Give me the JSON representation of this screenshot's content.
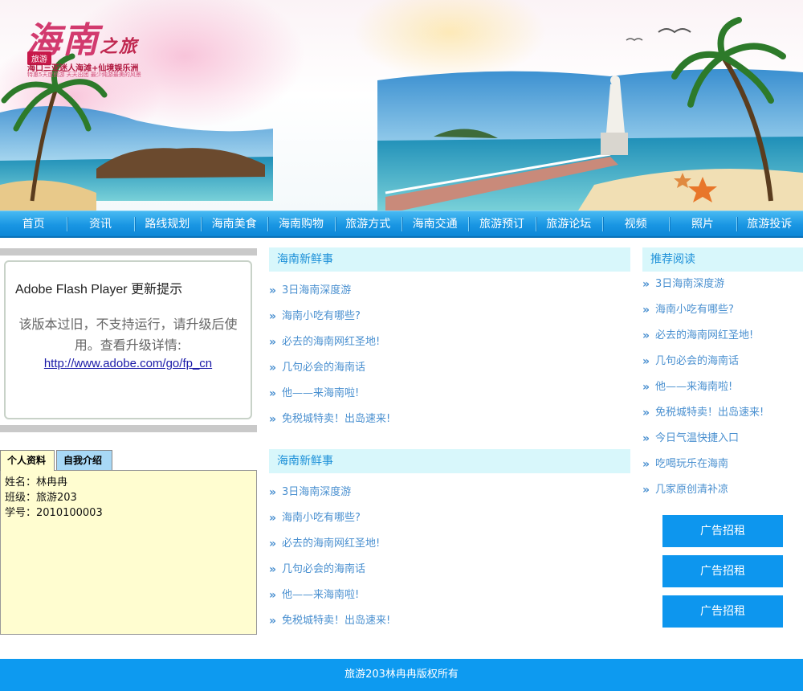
{
  "banner": {
    "logo_title": "海南",
    "logo_title_small": "之旅",
    "logo_badge": "旅游",
    "logo_sub": "海口三亚迷人海滩+仙境娱乐洲",
    "logo_tiny": "特惠5天度假游  天天出团  最少纯游最美的风景"
  },
  "nav": {
    "items": [
      "首页",
      "资讯",
      "路线规划",
      "海南美食",
      "海南购物",
      "旅游方式",
      "海南交通",
      "旅游预订",
      "旅游论坛",
      "视频",
      "照片",
      "旅游投诉"
    ]
  },
  "flash": {
    "title": "Adobe Flash Player 更新提示",
    "message": "该版本过旧，不支持运行，请升级后使用。查看升级详情:",
    "link": "http://www.adobe.com/go/fp_cn"
  },
  "profile": {
    "tabs": [
      "个人资料",
      "自我介绍"
    ],
    "rows": [
      "姓名：林冉冉",
      "班级：旅游203",
      "学号：2010100003"
    ]
  },
  "middle": {
    "sections": [
      {
        "title": "海南新鲜事",
        "items": [
          "3日海南深度游",
          "海南小吃有哪些?",
          "必去的海南网红圣地!",
          "几句必会的海南话",
          "他——来海南啦!",
          "免税城特卖！出岛速来!"
        ]
      },
      {
        "title": "海南新鲜事",
        "items": [
          "3日海南深度游",
          "海南小吃有哪些?",
          "必去的海南网红圣地!",
          "几句必会的海南话",
          "他——来海南啦!",
          "免税城特卖！出岛速来!"
        ]
      }
    ]
  },
  "right": {
    "title": "推荐阅读",
    "items": [
      "3日海南深度游",
      "海南小吃有哪些?",
      "必去的海南网红圣地!",
      "几句必会的海南话",
      "他——来海南啦!",
      "免税城特卖！出岛速来!",
      "今日气温快捷入口",
      "吃喝玩乐在海南",
      "几家原创清补凉"
    ],
    "ads": [
      "广告招租",
      "广告招租",
      "广告招租"
    ]
  },
  "footer": {
    "text": "旅游203林冉冉版权所有"
  },
  "colors": {
    "accent": "#0d96ee",
    "link": "#4a90d0",
    "section_bg": "#d8f7fb",
    "profile_bg": "#fffdd0"
  }
}
